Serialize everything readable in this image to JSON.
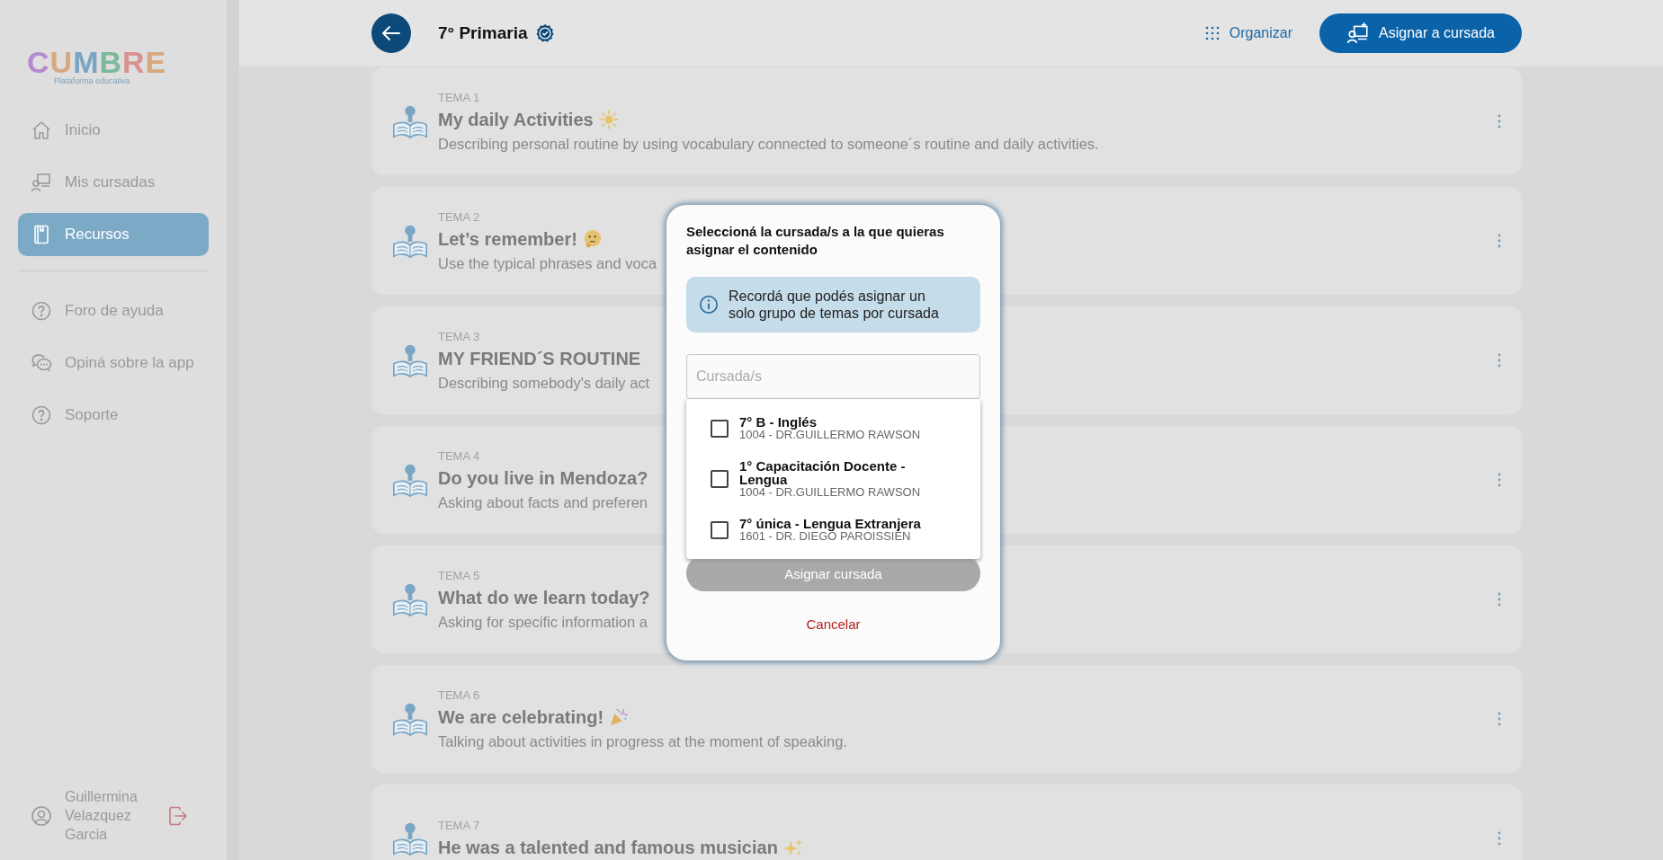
{
  "sidebar": {
    "logo": {
      "text": "CUMBRE",
      "subtitle": "Plataforma educativa"
    },
    "items": [
      {
        "label": "Inicio",
        "selected": false
      },
      {
        "label": "Mis cursadas",
        "selected": false
      },
      {
        "label": "Recursos",
        "selected": true
      }
    ],
    "secondary": [
      {
        "label": "Foro de ayuda"
      },
      {
        "label": "Opiná sobre la app"
      },
      {
        "label": "Soporte"
      }
    ],
    "user": {
      "name": "Guillermina Velazquez Garcia"
    }
  },
  "header": {
    "title": "7° Primaria",
    "verified": true,
    "organize": "Organizar",
    "assign": "Asignar a cursada"
  },
  "topics": [
    {
      "label": "TEMA 1",
      "title": "My daily Activities",
      "description": "Describing personal routine by using vocabulary connected to someone´s routine and daily activities."
    },
    {
      "label": "TEMA 2",
      "title": "Let’s remember!",
      "description": "Use the typical phrases and voca"
    },
    {
      "label": "TEMA 3",
      "title": "MY FRIEND´S ROUTINE",
      "description": "Describing somebody's daily act"
    },
    {
      "label": "TEMA 4",
      "title": "Do you live in Mendoza?",
      "description": "Asking about facts and preferen"
    },
    {
      "label": "TEMA 5",
      "title": "What do we learn today?",
      "description": "Asking for specific information a"
    },
    {
      "label": "TEMA 6",
      "title": "We are celebrating!",
      "description": "Talking about activities in progress at the moment of speaking."
    },
    {
      "label": "TEMA 7",
      "title": "He was a talented and famous musician"
    }
  ],
  "dialog": {
    "heading": "Seleccioná la cursada/s a la que quieras asignar el contenido",
    "info": "Recordá que podés asignar un solo grupo de temas por cursada",
    "search": {
      "placeholder": "Cursada/s"
    },
    "options": [
      {
        "name": "7° B - Inglés",
        "school": "1004 - DR.GUILLERMO RAWSON",
        "checked": false
      },
      {
        "name": "1° Capacitación Docente - Lengua",
        "school": "1004 - DR.GUILLERMO RAWSON",
        "checked": false
      },
      {
        "name": "7° única - Lengua Extranjera",
        "school": "1601 - DR. DIEGO PAROISSIEN",
        "checked": false
      }
    ],
    "confirm": {
      "label": "Asignar cursada",
      "disabled": true
    },
    "cancel": "Cancelar"
  }
}
